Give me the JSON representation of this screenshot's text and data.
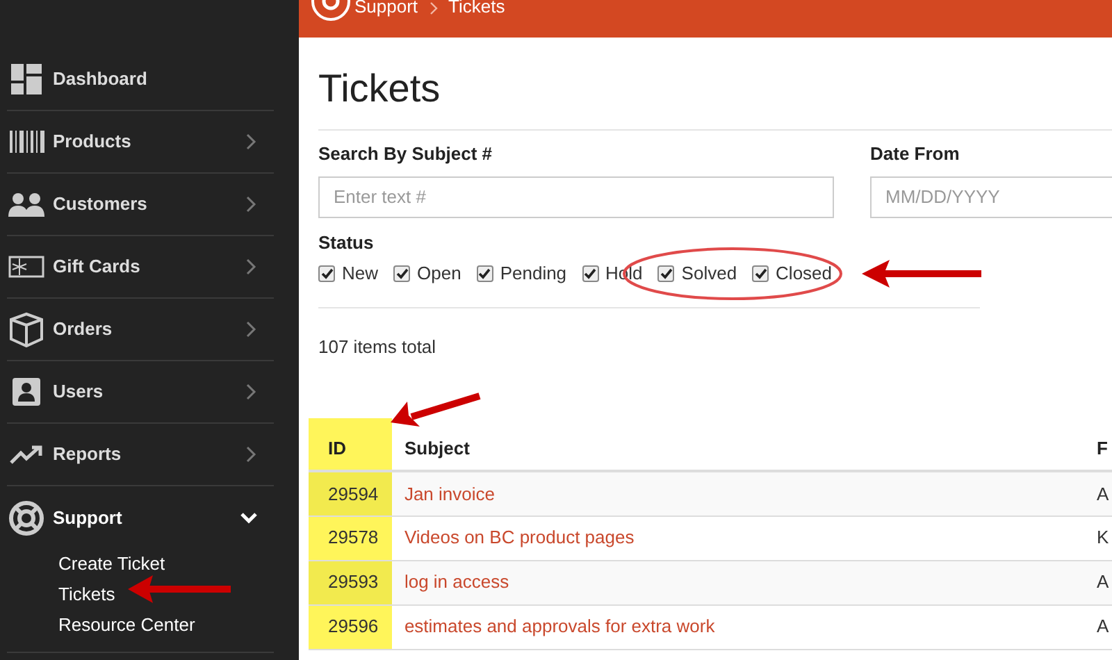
{
  "sidebar": {
    "items": [
      {
        "label": "Dashboard",
        "kind": "link"
      },
      {
        "label": "Products",
        "kind": "menu",
        "expanded": false
      },
      {
        "label": "Customers",
        "kind": "menu",
        "expanded": false
      },
      {
        "label": "Gift Cards",
        "kind": "menu",
        "expanded": false
      },
      {
        "label": "Orders",
        "kind": "menu",
        "expanded": false
      },
      {
        "label": "Users",
        "kind": "menu",
        "expanded": false
      },
      {
        "label": "Reports",
        "kind": "menu",
        "expanded": false
      },
      {
        "label": "Support",
        "kind": "menu",
        "expanded": true,
        "children": [
          {
            "label": "Create Ticket"
          },
          {
            "label": "Tickets"
          },
          {
            "label": "Resource Center"
          }
        ]
      }
    ]
  },
  "breadcrumb": [
    "Support",
    "Tickets"
  ],
  "title": "Tickets",
  "filters": {
    "search": {
      "label": "Search By Subject #",
      "placeholder": "Enter text #"
    },
    "date_from": {
      "label": "Date From",
      "placeholder": "MM/DD/YYYY"
    },
    "status": {
      "label": "Status",
      "options": [
        {
          "label": "New",
          "checked": true
        },
        {
          "label": "Open",
          "checked": true
        },
        {
          "label": "Pending",
          "checked": true
        },
        {
          "label": "Hold",
          "checked": true
        },
        {
          "label": "Solved",
          "checked": true
        },
        {
          "label": "Closed",
          "checked": true
        }
      ]
    }
  },
  "total": "107 items total",
  "table": {
    "columns": [
      "ID",
      "Subject",
      "F"
    ],
    "rows": [
      [
        "29594",
        "Jan invoice",
        "A"
      ],
      [
        "29578",
        "Videos on BC product pages",
        "K"
      ],
      [
        "29593",
        "log in access",
        "A"
      ],
      [
        "29596",
        "estimates and approvals for extra work",
        "A"
      ]
    ]
  }
}
